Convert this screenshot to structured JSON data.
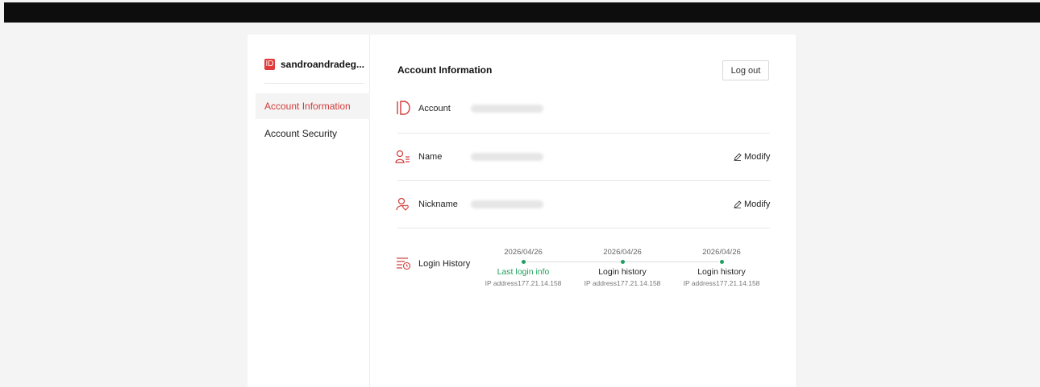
{
  "sidebar": {
    "badge": "ID",
    "username": "sandroandradeg...",
    "items": [
      {
        "label": "Account Information"
      },
      {
        "label": "Account Security"
      }
    ]
  },
  "main": {
    "title": "Account Information",
    "logout_label": "Log out",
    "rows": {
      "account": {
        "label": "Account"
      },
      "name": {
        "label": "Name",
        "action": "Modify"
      },
      "nickname": {
        "label": "Nickname",
        "action": "Modify"
      },
      "login_history": {
        "label": "Login History"
      }
    },
    "timeline": [
      {
        "date": "2026/04/26",
        "title": "Last login info",
        "ip": "IP address177.21.14.158"
      },
      {
        "date": "2026/04/26",
        "title": "Login history",
        "ip": "IP address177.21.14.158"
      },
      {
        "date": "2026/04/26",
        "title": "Login history",
        "ip": "IP address177.21.14.158"
      }
    ]
  },
  "colors": {
    "accent": "#d23a3a",
    "success": "#20a060"
  }
}
